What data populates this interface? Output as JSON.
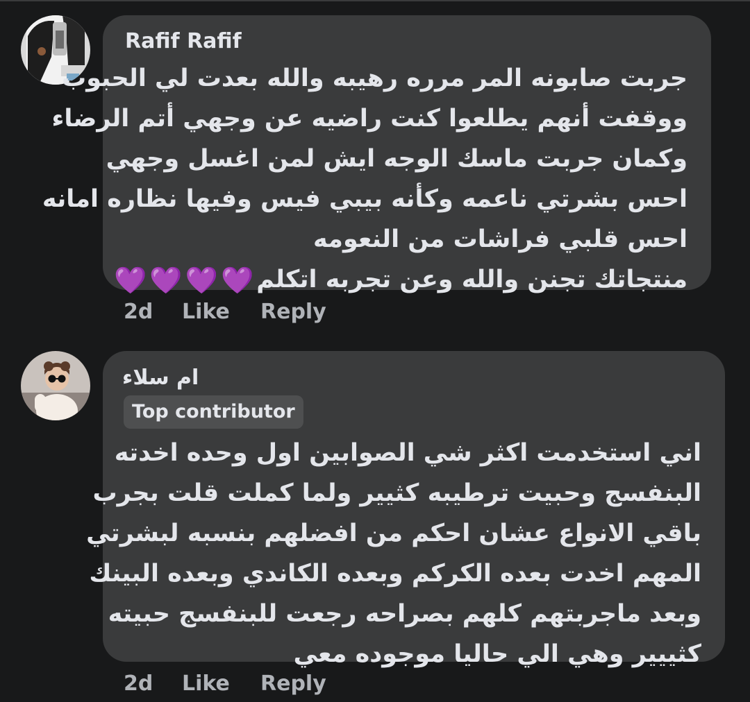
{
  "comments": [
    {
      "author": "Rafif Rafif",
      "avatar_icon": "user-avatar",
      "badge": "",
      "lines": [
        "جربت صابونه المر مرره رهيبه والله بعدت لي الحبوب",
        "ووقفت أنهم يطلعوا كنت راضيه عن وجهي أتم الرضاء",
        "وكمان جربت ماسك الوجه ايش لمن اغسل وجهي",
        "احس بشرتي ناعمه وكأنه بيبي فيس وفيها نظاره امانه",
        "احس قلبي فراشات من النعومه",
        "منتجاتك تجنن والله وعن تجربه اتكلم"
      ],
      "hearts": [
        "💜",
        "💜",
        "💜",
        "💜"
      ],
      "time": "2d",
      "like_label": "Like",
      "reply_label": "Reply"
    },
    {
      "author": "ام سلاء",
      "avatar_icon": "user-avatar",
      "badge": "Top contributor",
      "lines": [
        "اني استخدمت اكثر شي الصوابين اول وحده اخدته",
        "البنفسج وحبيت ترطيبه كثيير ولما كملت قلت بجرب",
        "باقي الانواع عشان احكم من افضلهم بنسبه لبشرتي",
        "المهم اخدت بعده الكركم وبعده الكاندي وبعده البينك",
        "وبعد ماجربتهم كلهم بصراحه رجعت للبنفسج حبيته",
        "كثييير وهي الي حاليا موجوده معي"
      ],
      "time": "2d",
      "like_label": "Like",
      "reply_label": "Reply"
    }
  ],
  "colors": {
    "background": "#18191a",
    "bubble": "#3a3b3c",
    "text": "#e4e6eb",
    "secondary_text": "#b0b3b8",
    "heart": "#b44bf0",
    "badge": "#4e4f50"
  }
}
